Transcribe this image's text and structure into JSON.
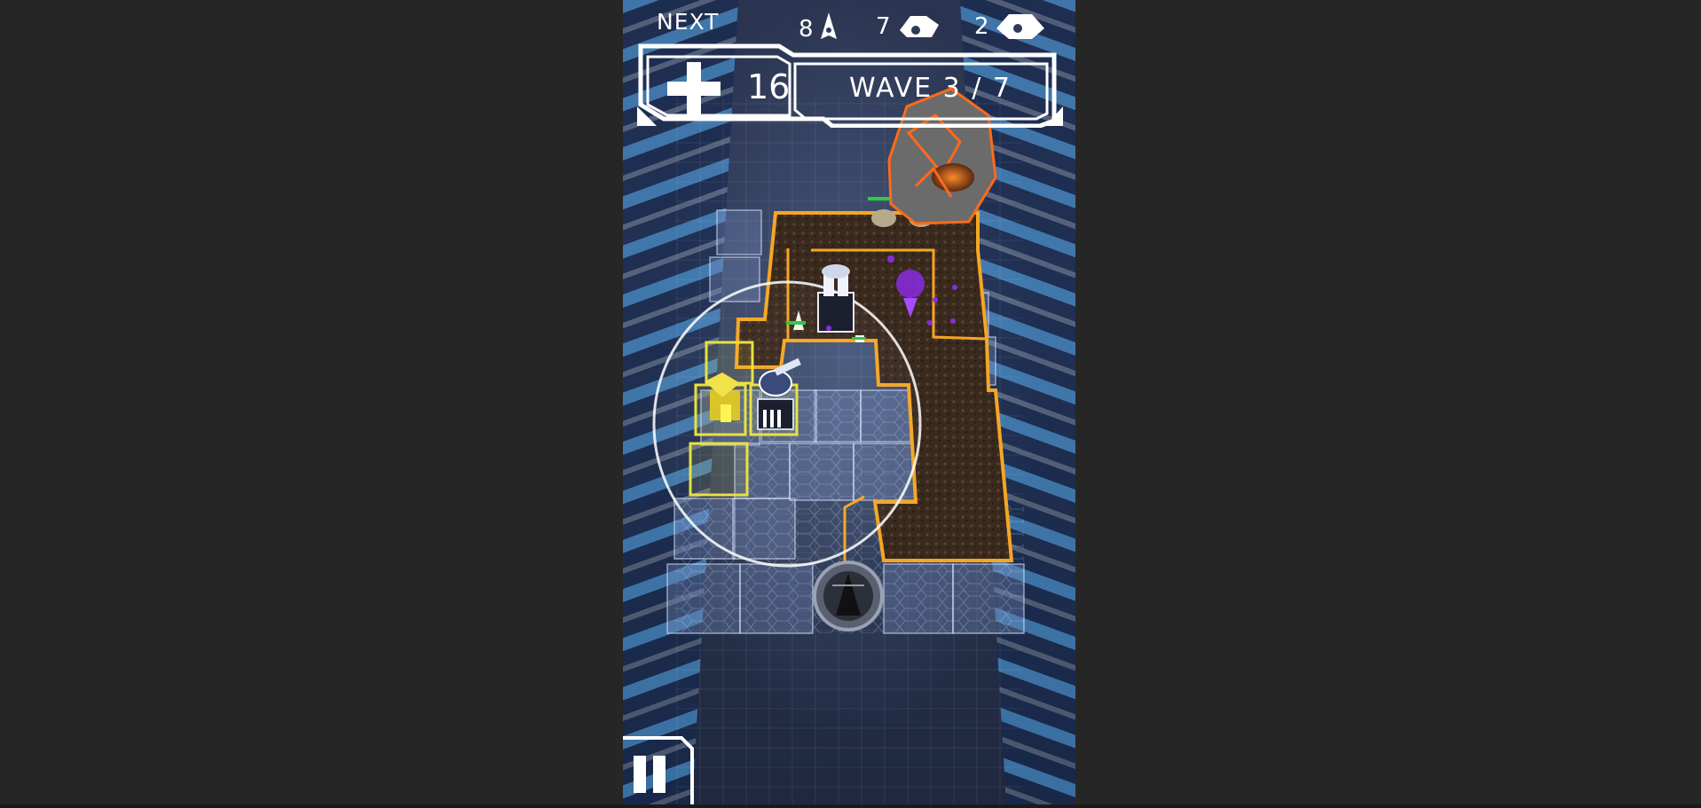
{
  "hud": {
    "next_label": "NEXT",
    "enemy_counts": [
      {
        "count": "8",
        "icon": "dart-enemy-icon"
      },
      {
        "count": "7",
        "icon": "tank-enemy-icon"
      },
      {
        "count": "2",
        "icon": "heavy-enemy-icon"
      }
    ],
    "lives": "16",
    "wave_label": "WAVE 3 / 7"
  },
  "colors": {
    "path_outline": "#f5a623",
    "build_highlight": "#e8e03a",
    "health_bar": "#2ecc40",
    "enemy_purple": "#8a2be2",
    "boss_orange": "#ff6a1a"
  },
  "controls": {
    "pause_icon": "pause-icon"
  }
}
